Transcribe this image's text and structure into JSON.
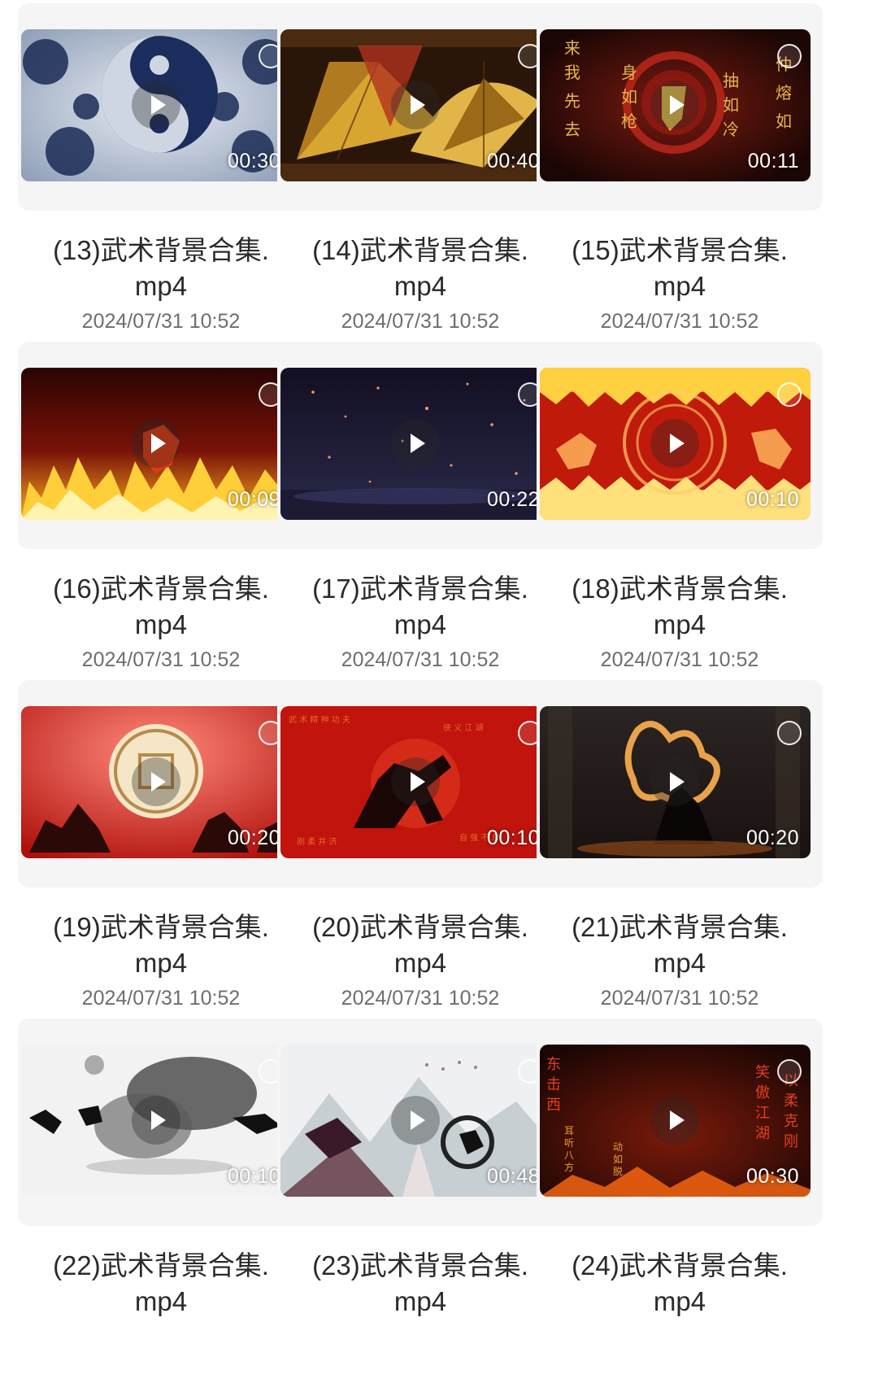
{
  "videos": [
    {
      "name": "(13)武术背景合集.mp4",
      "name_line1": "(13)武术背景合集.",
      "name_line2": "mp4",
      "date": "2024/07/31 10:52",
      "duration": "00:30",
      "theme": "taiji"
    },
    {
      "name": "(14)武术背景合集.mp4",
      "name_line1": "(14)武术背景合集.",
      "name_line2": "mp4",
      "date": "2024/07/31 10:52",
      "duration": "00:40",
      "theme": "fans"
    },
    {
      "name": "(15)武术背景合集.mp4",
      "name_line1": "(15)武术背景合集.",
      "name_line2": "mp4",
      "date": "2024/07/31 10:52",
      "duration": "00:11",
      "theme": "red-text"
    },
    {
      "name": "(16)武术背景合集.mp4",
      "name_line1": "(16)武术背景合集.",
      "name_line2": "mp4",
      "date": "2024/07/31 10:52",
      "duration": "00:09",
      "theme": "fire"
    },
    {
      "name": "(17)武术背景合集.mp4",
      "name_line1": "(17)武术背景合集.",
      "name_line2": "mp4",
      "date": "2024/07/31 10:52",
      "duration": "00:22",
      "theme": "night"
    },
    {
      "name": "(18)武术背景合集.mp4",
      "name_line1": "(18)武术背景合集.",
      "name_line2": "mp4",
      "date": "2024/07/31 10:52",
      "duration": "00:10",
      "theme": "fire-circle"
    },
    {
      "name": "(19)武术背景合集.mp4",
      "name_line1": "(19)武术背景合集.",
      "name_line2": "mp4",
      "date": "2024/07/31 10:52",
      "duration": "00:20",
      "theme": "red-medallion"
    },
    {
      "name": "(20)武术背景合集.mp4",
      "name_line1": "(20)武术背景合集.",
      "name_line2": "mp4",
      "date": "2024/07/31 10:52",
      "duration": "00:10",
      "theme": "red-kungfu"
    },
    {
      "name": "(21)武术背景合集.mp4",
      "name_line1": "(21)武术背景合集.",
      "name_line2": "mp4",
      "date": "2024/07/31 10:52",
      "duration": "00:20",
      "theme": "dark-fire"
    },
    {
      "name": "(22)武术背景合集.mp4",
      "name_line1": "(22)武术背景合集.",
      "name_line2": "mp4",
      "date": "",
      "duration": "00:10",
      "theme": "ink"
    },
    {
      "name": "(23)武术背景合集.mp4",
      "name_line1": "(23)武术背景合集.",
      "name_line2": "mp4",
      "date": "",
      "duration": "00:48",
      "theme": "ink-mountain"
    },
    {
      "name": "(24)武术背景合集.mp4",
      "name_line1": "(24)武术背景合集.",
      "name_line2": "mp4",
      "date": "",
      "duration": "00:30",
      "theme": "red-jianghu"
    }
  ],
  "icons": {
    "play": "play-icon",
    "select": "select-circle-icon"
  },
  "colors": {
    "background": "#ffffff",
    "card": "#f5f5f5",
    "title_text": "#2a2a2a",
    "date_text": "#6e6e6e",
    "duration_text": "#ffffff"
  }
}
